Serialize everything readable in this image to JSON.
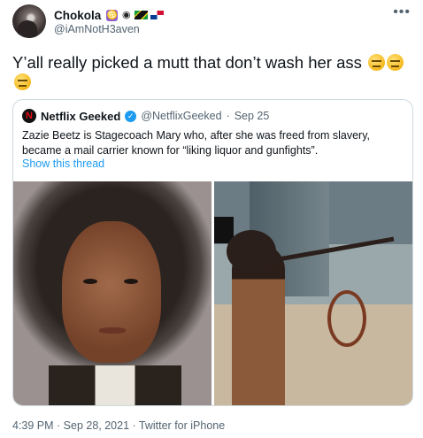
{
  "header": {
    "display_name": "Chokola",
    "handle": "@iAmNotH3aven",
    "more_label": "•••"
  },
  "tweet": {
    "text": "Y’all really picked a mutt that don’t wash her ass"
  },
  "quote": {
    "name": "Netflix Geeked",
    "handle": "@NetflixGeeked",
    "separator": "·",
    "date": "Sep 25",
    "text": "Zazie Beetz is Stagecoach Mary who, after she was freed from slavery, became a mail carrier known for “liking liquor and gunfights”.",
    "link": "Show this thread"
  },
  "footer": {
    "meta": "4:39 PM · Sep 28, 2021 · Twitter for iPhone"
  },
  "icons": [
    "cancer-sign-icon",
    "ninja-icon",
    "jamaica-flag-icon",
    "panama-flag-icon",
    "expressionless-face-icon",
    "verified-badge-icon",
    "netflix-logo-icon"
  ],
  "colors": {
    "link": "#1d9bf0",
    "secondary_text": "#536471",
    "border": "#cfd9de"
  }
}
